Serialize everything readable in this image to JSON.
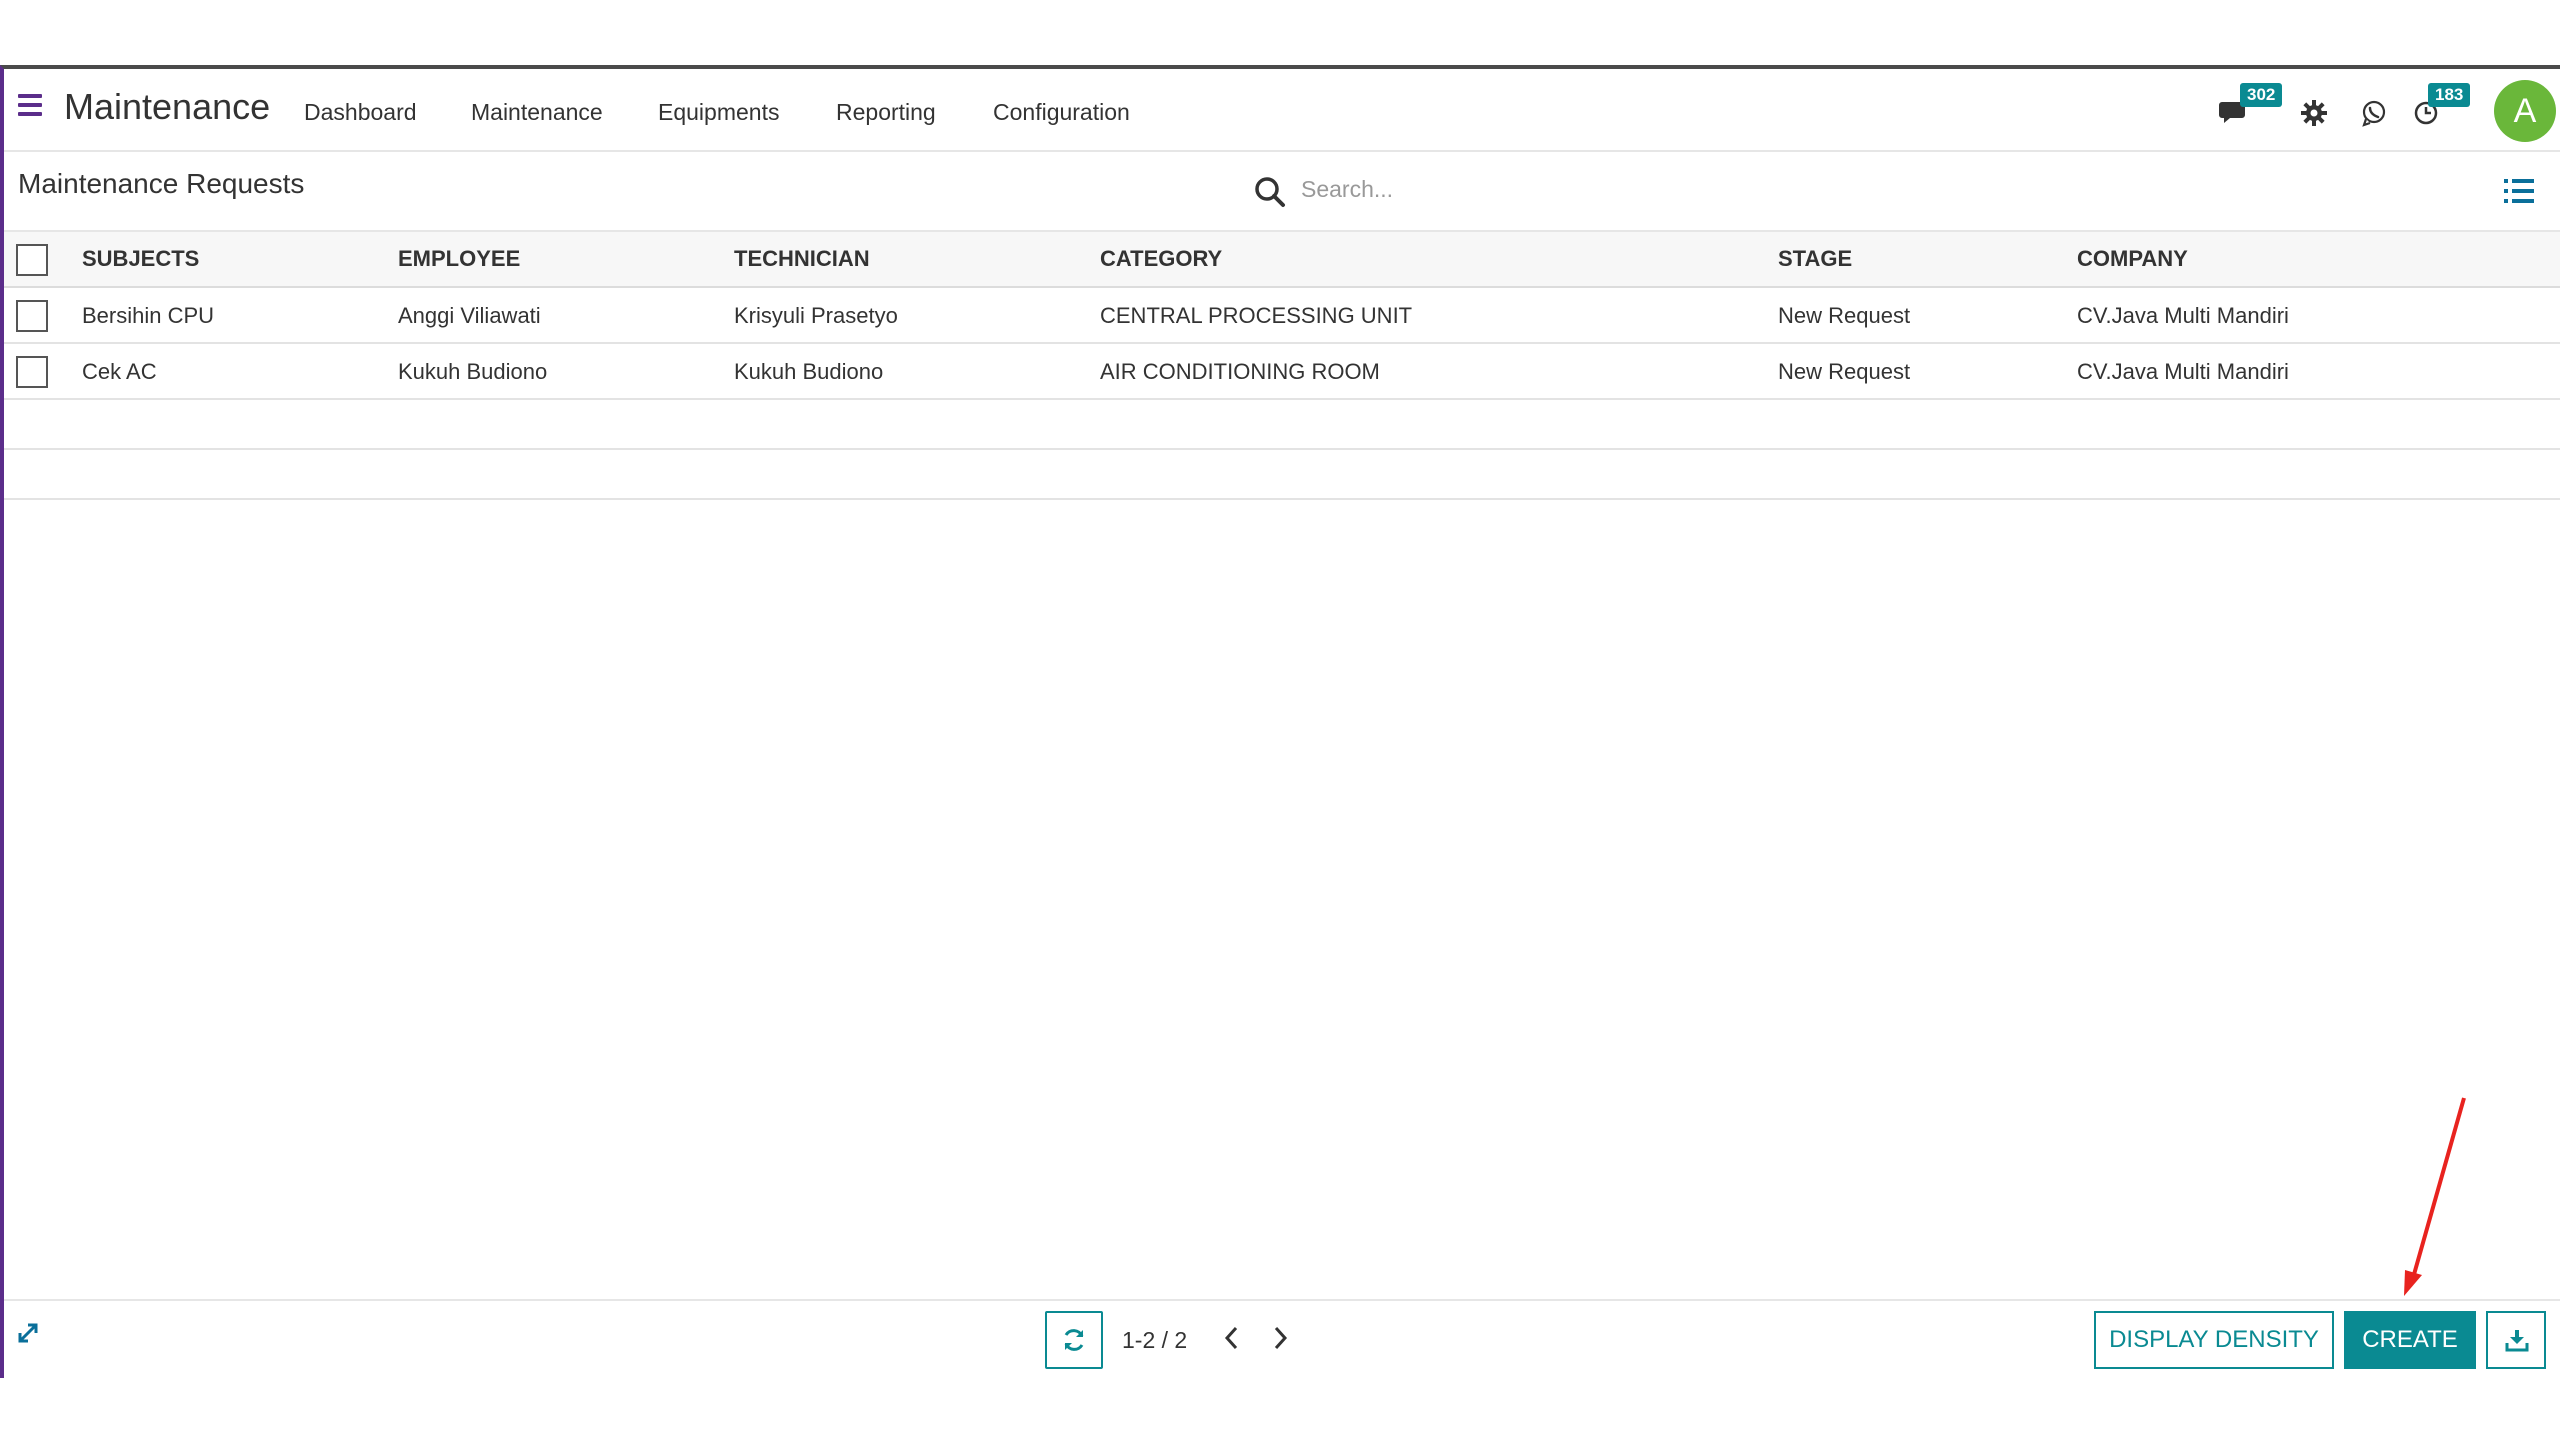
{
  "navbar": {
    "app_title": "Maintenance",
    "menus": [
      "Dashboard",
      "Maintenance",
      "Equipments",
      "Reporting",
      "Configuration"
    ],
    "messages_badge": "302",
    "activity_badge": "183",
    "avatar_initial": "A",
    "accent_color": "#5b2d8a",
    "badge_color": "#0a8a92"
  },
  "control": {
    "page_title": "Maintenance Requests",
    "search_placeholder": "Search..."
  },
  "table": {
    "columns": [
      "SUBJECTS",
      "EMPLOYEE",
      "TECHNICIAN",
      "CATEGORY",
      "STAGE",
      "COMPANY"
    ],
    "rows": [
      {
        "subject": "Bersihin CPU",
        "employee": "Anggi Viliawati",
        "technician": "Krisyuli Prasetyo",
        "category": "CENTRAL PROCESSING UNIT",
        "stage": "New Request",
        "company": "CV.Java Multi Mandiri"
      },
      {
        "subject": "Cek AC",
        "employee": "Kukuh Budiono",
        "technician": "Kukuh Budiono",
        "category": "AIR CONDITIONING ROOM",
        "stage": "New Request",
        "company": "CV.Java Multi Mandiri"
      }
    ]
  },
  "footer": {
    "pager_value": "1-2 / 2",
    "display_density_label": "DISPLAY DENSITY",
    "create_label": "CREATE",
    "primary_color": "#0a8a92"
  },
  "annotation": {
    "arrow_color": "#e8231f",
    "arrow_target": "create-button"
  }
}
